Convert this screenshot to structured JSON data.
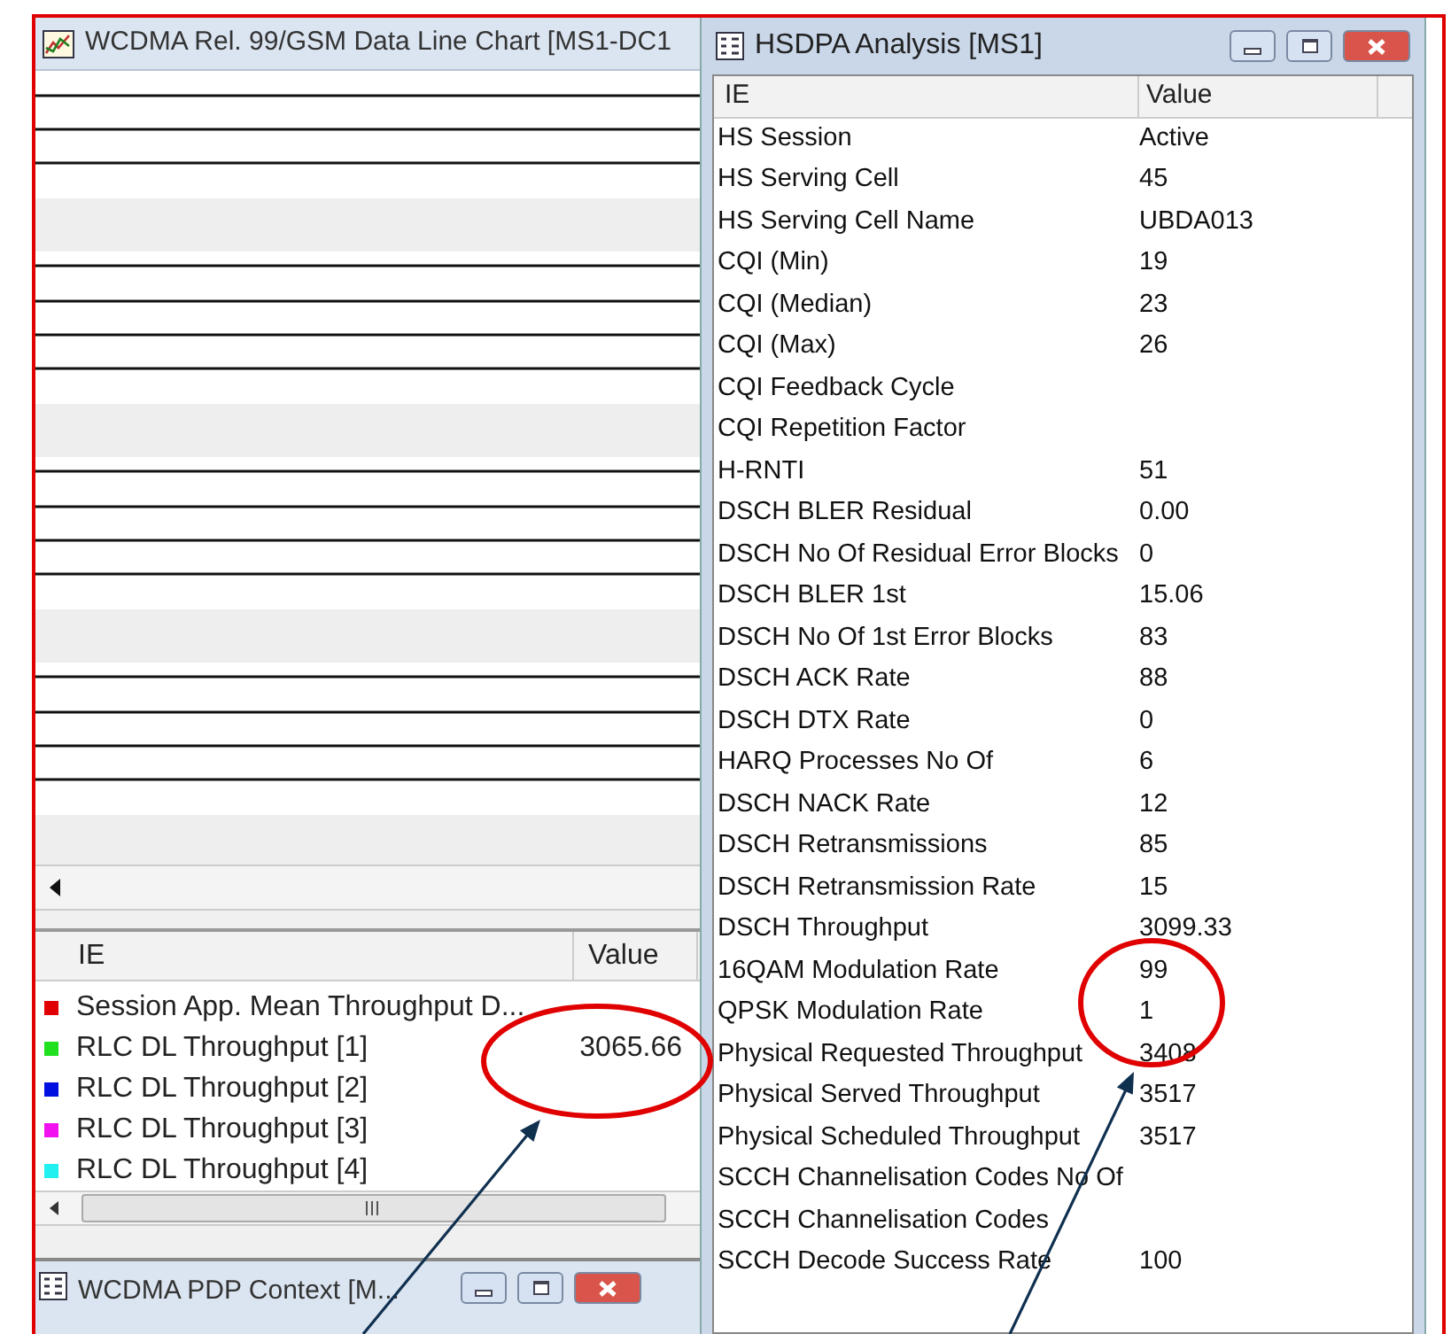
{
  "chart_window": {
    "title": "WCDMA Rel. 99/GSM Data Line Chart [MS1-DC1",
    "legend": {
      "columns": [
        "IE",
        "Value"
      ],
      "rows": [
        {
          "ie": "Session App. Mean Throughput D...",
          "value": "",
          "color": "#e00000"
        },
        {
          "ie": "RLC DL Throughput [1]",
          "value": "3065.66",
          "color": "#20e020"
        },
        {
          "ie": "RLC DL Throughput [2]",
          "value": "",
          "color": "#0010e0"
        },
        {
          "ie": "RLC DL Throughput [3]",
          "value": "",
          "color": "#f010f0"
        },
        {
          "ie": "RLC DL Throughput [4]",
          "value": "",
          "color": "#20f0f0"
        }
      ]
    }
  },
  "pdp_window": {
    "title": "WCDMA PDP Context [M..."
  },
  "hsdpa_window": {
    "title": "HSDPA Analysis [MS1]",
    "columns": [
      "IE",
      "Value"
    ],
    "rows": [
      {
        "ie": "HS Session",
        "value": "Active"
      },
      {
        "ie": "HS Serving Cell",
        "value": "45"
      },
      {
        "ie": "HS Serving Cell Name",
        "value": "UBDA013"
      },
      {
        "ie": "CQI (Min)",
        "value": "19"
      },
      {
        "ie": "CQI (Median)",
        "value": "23"
      },
      {
        "ie": "CQI (Max)",
        "value": "26"
      },
      {
        "ie": "CQI Feedback Cycle",
        "value": ""
      },
      {
        "ie": "CQI Repetition Factor",
        "value": ""
      },
      {
        "ie": "H-RNTI",
        "value": "51"
      },
      {
        "ie": "DSCH BLER Residual",
        "value": "0.00"
      },
      {
        "ie": "DSCH No Of Residual Error Blocks",
        "value": "0"
      },
      {
        "ie": "DSCH BLER 1st",
        "value": "15.06"
      },
      {
        "ie": "DSCH No Of 1st Error Blocks",
        "value": "83"
      },
      {
        "ie": "DSCH ACK Rate",
        "value": "88"
      },
      {
        "ie": "DSCH DTX Rate",
        "value": "0"
      },
      {
        "ie": "HARQ Processes No Of",
        "value": "6"
      },
      {
        "ie": "DSCH NACK Rate",
        "value": "12"
      },
      {
        "ie": "DSCH Retransmissions",
        "value": "85"
      },
      {
        "ie": "DSCH Retransmission Rate",
        "value": "15"
      },
      {
        "ie": "DSCH Throughput",
        "value": "3099.33"
      },
      {
        "ie": "16QAM Modulation Rate",
        "value": "99"
      },
      {
        "ie": "QPSK Modulation Rate",
        "value": "1"
      },
      {
        "ie": "Physical Requested Throughput",
        "value": "3408"
      },
      {
        "ie": "Physical Served Throughput",
        "value": "3517"
      },
      {
        "ie": "Physical Scheduled Throughput",
        "value": "3517"
      },
      {
        "ie": "SCCH Channelisation Codes No Of",
        "value": ""
      },
      {
        "ie": "SCCH Channelisation Codes",
        "value": ""
      },
      {
        "ie": "SCCH Decode Success Rate",
        "value": "100"
      }
    ]
  }
}
